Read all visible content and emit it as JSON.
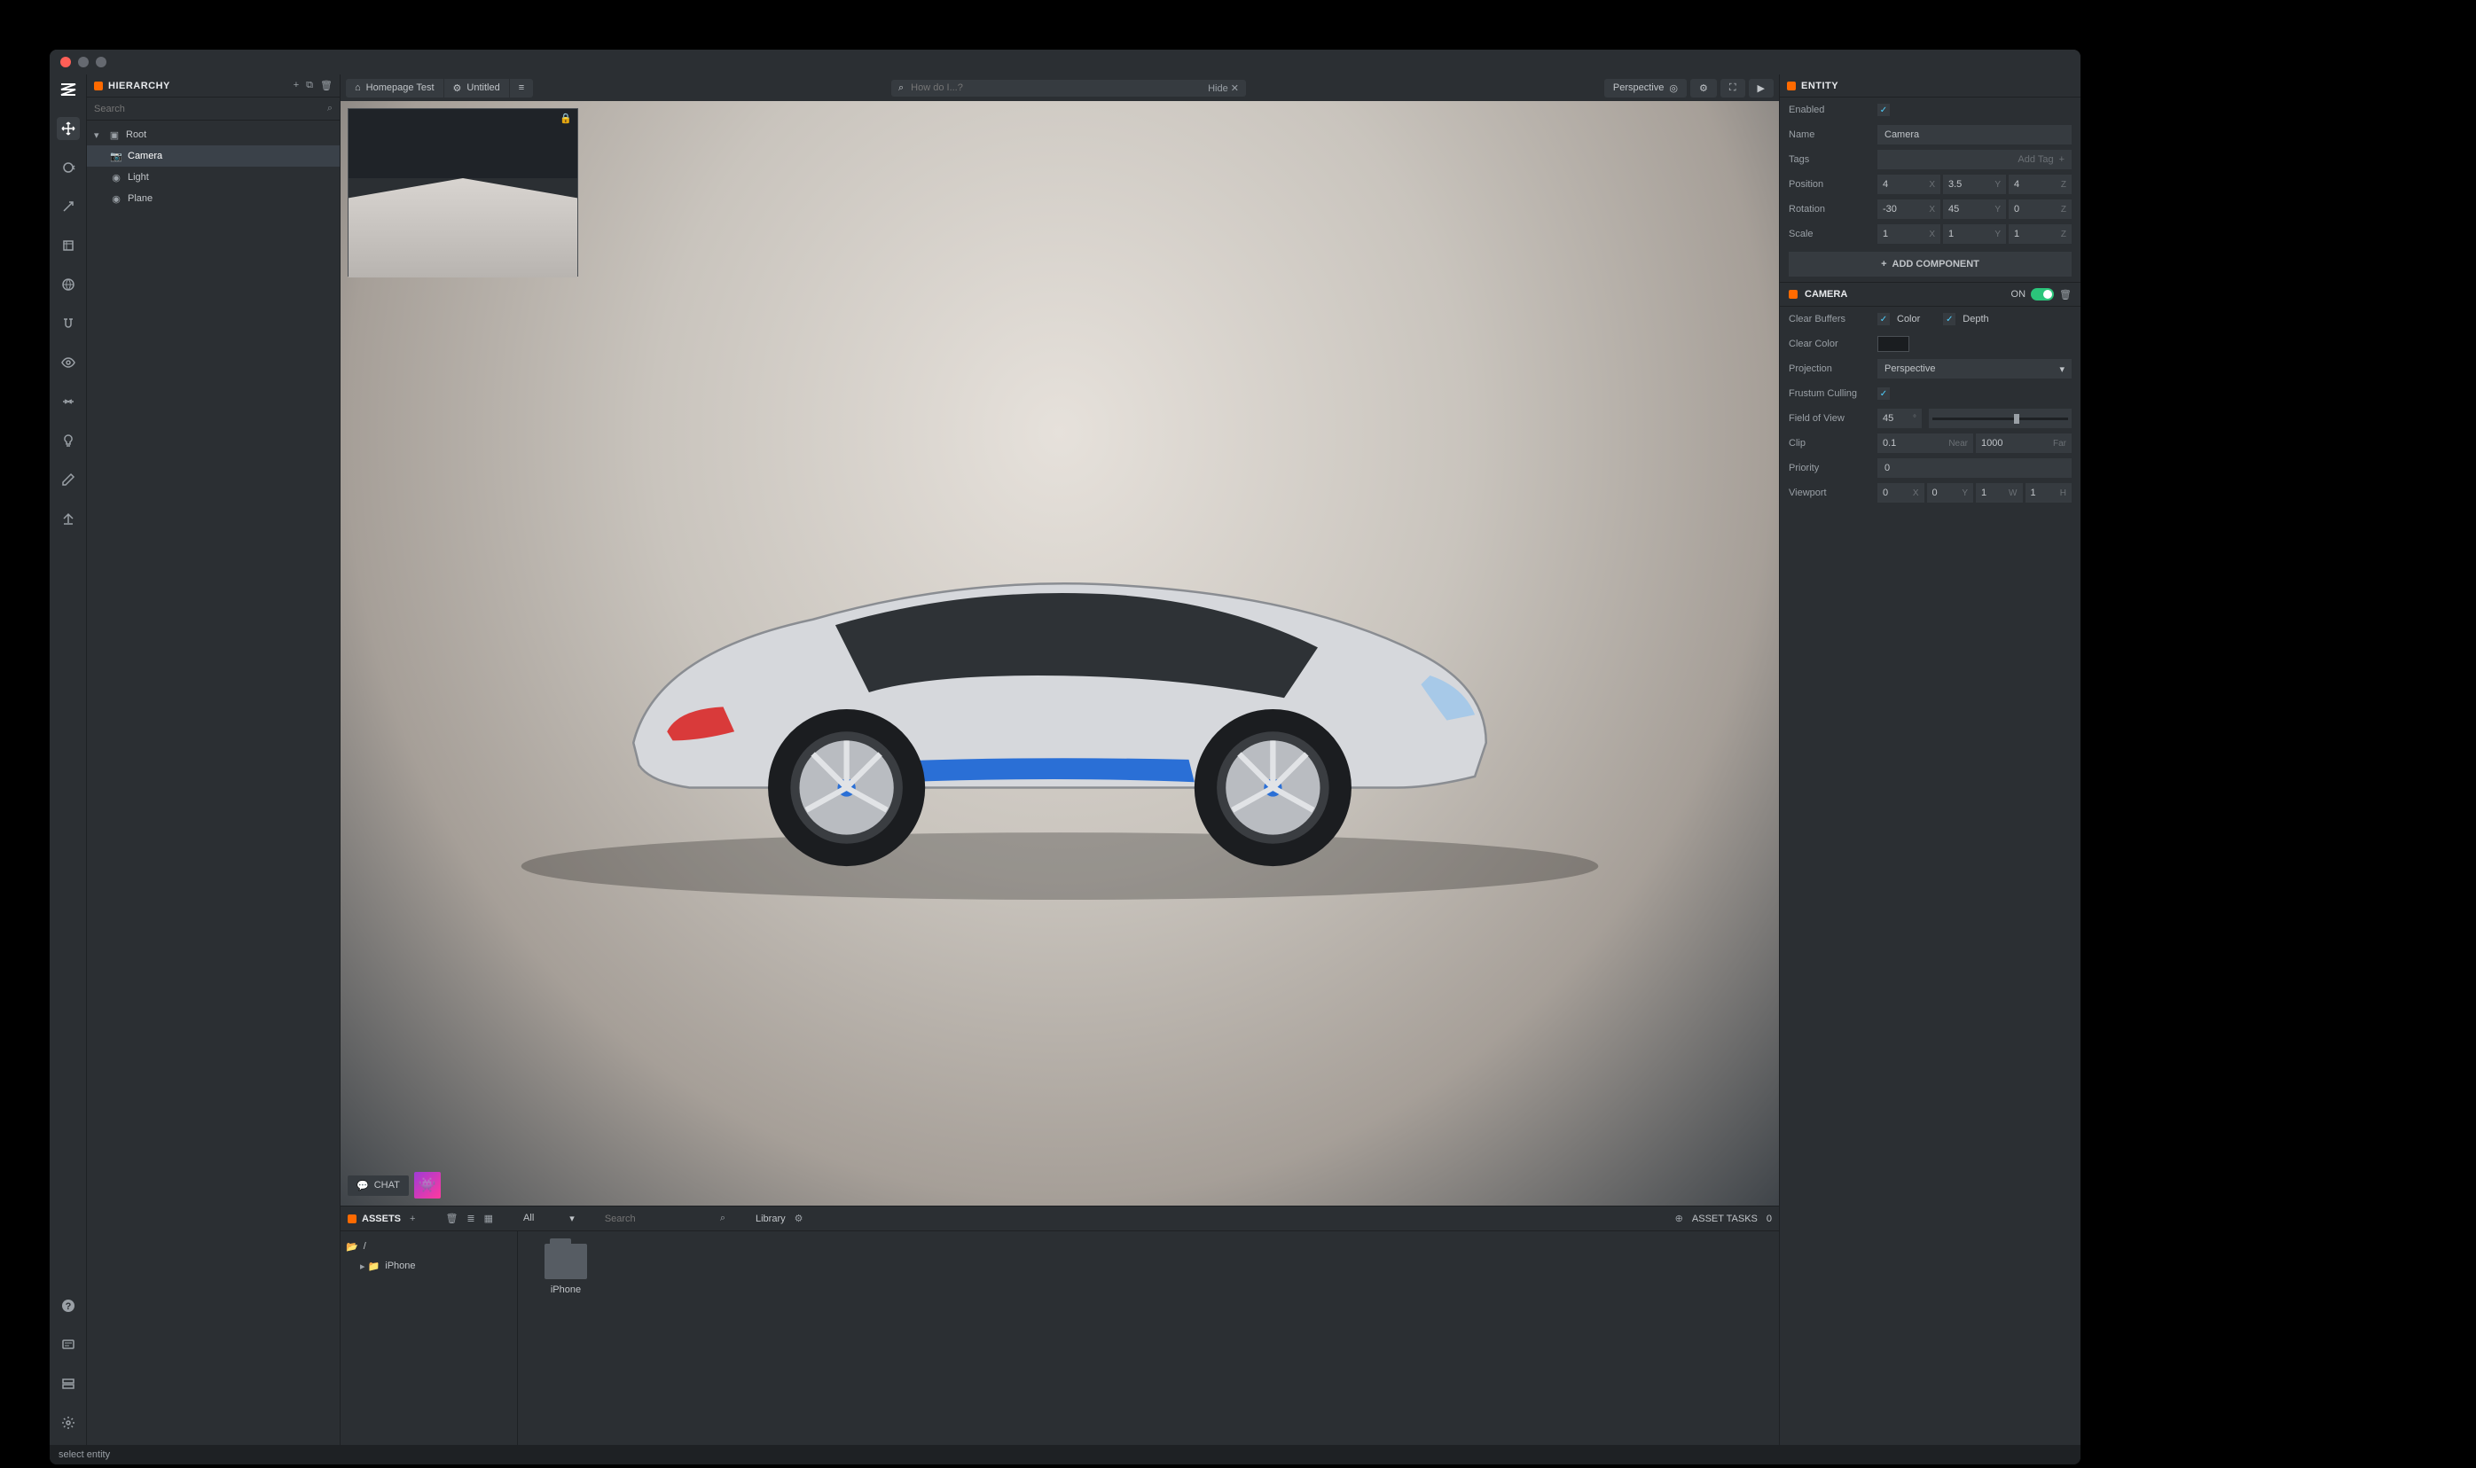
{
  "hierarchy": {
    "title": "HIERARCHY",
    "search_placeholder": "Search",
    "items": [
      {
        "label": "Root",
        "icon": "folder",
        "indent": 0,
        "expanded": true
      },
      {
        "label": "Camera",
        "icon": "camera",
        "indent": 1,
        "selected": true
      },
      {
        "label": "Light",
        "icon": "light",
        "indent": 1
      },
      {
        "label": "Plane",
        "icon": "plane",
        "indent": 1
      }
    ]
  },
  "viewport": {
    "tabs": [
      {
        "icon": "home",
        "label": "Homepage Test"
      },
      {
        "icon": "gear",
        "label": "Untitled"
      }
    ],
    "list_icon": "list",
    "search_placeholder": "How do I...?",
    "search_hide": "Hide ✕",
    "projection_label": "Perspective",
    "chat_label": "CHAT"
  },
  "assets": {
    "title": "ASSETS",
    "filter_label": "All",
    "search_placeholder": "Search",
    "library_label": "Library",
    "tasks_label": "ASSET TASKS",
    "tasks_count": "0",
    "tree": [
      {
        "label": "/",
        "icon": "folder-open"
      },
      {
        "label": "iPhone",
        "icon": "folder",
        "indent": 1
      }
    ],
    "grid": [
      {
        "label": "iPhone"
      }
    ]
  },
  "entity": {
    "title": "ENTITY",
    "enabled_label": "Enabled",
    "enabled": true,
    "name_label": "Name",
    "name_value": "Camera",
    "tags_label": "Tags",
    "tags_placeholder": "Add Tag",
    "position_label": "Position",
    "position": {
      "x": "4",
      "y": "3.5",
      "z": "4"
    },
    "rotation_label": "Rotation",
    "rotation": {
      "x": "-30",
      "y": "45",
      "z": "0"
    },
    "scale_label": "Scale",
    "scale": {
      "x": "1",
      "y": "1",
      "z": "1"
    },
    "add_component": "ADD COMPONENT"
  },
  "camera": {
    "title": "CAMERA",
    "on_label": "ON",
    "clear_buffers_label": "Clear Buffers",
    "clear_color_cb": "Color",
    "clear_depth_cb": "Depth",
    "clear_color_label": "Clear Color",
    "projection_label": "Projection",
    "projection_value": "Perspective",
    "frustum_label": "Frustum Culling",
    "fov_label": "Field of View",
    "fov_value": "45",
    "clip_label": "Clip",
    "clip_near": "0.1",
    "clip_near_label": "Near",
    "clip_far": "1000",
    "clip_far_label": "Far",
    "priority_label": "Priority",
    "priority_value": "0",
    "viewport_label": "Viewport",
    "viewport": {
      "x": "0",
      "y": "0",
      "w": "1",
      "h": "1"
    }
  },
  "statusbar": {
    "text": "select entity"
  }
}
